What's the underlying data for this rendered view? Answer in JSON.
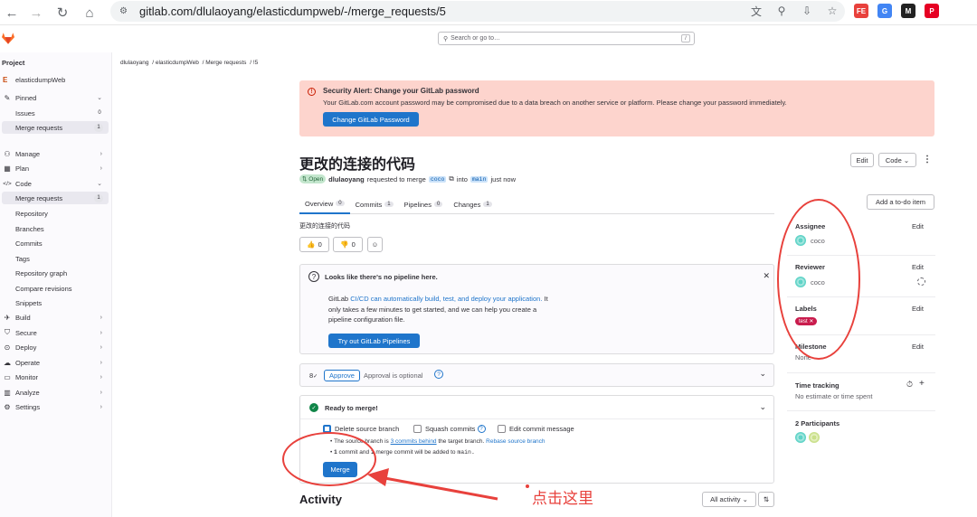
{
  "browser": {
    "url": "gitlab.com/dlulaoyang/elasticdumpweb/-/merge_requests/5",
    "extensions": [
      {
        "name": "fe-extension-icon",
        "label": "FE",
        "color": "#e8413c"
      },
      {
        "name": "translate-extension-icon",
        "label": "G",
        "color": "#4285f4"
      },
      {
        "name": "m-extension-icon",
        "label": "M",
        "color": "#222222"
      },
      {
        "name": "pinterest-extension-icon",
        "label": "P",
        "color": "#e60023"
      }
    ]
  },
  "topbar": {
    "search_placeholder": "Search or go to…",
    "search_kbd": "/"
  },
  "sidebar": {
    "heading": "Project",
    "project_initial": "E",
    "project_name": "elasticdumpWeb",
    "pinned": "Pinned",
    "issues": "Issues",
    "issues_count": "0",
    "merge_requests": "Merge requests",
    "mr_count": "1",
    "manage": "Manage",
    "plan": "Plan",
    "code": "Code",
    "code_items": [
      "Merge requests",
      "Repository",
      "Branches",
      "Commits",
      "Tags",
      "Repository graph",
      "Compare revisions",
      "Snippets"
    ],
    "code_mr_count": "1",
    "build": "Build",
    "secure": "Secure",
    "deploy": "Deploy",
    "operate": "Operate",
    "monitor": "Monitor",
    "analyze": "Analyze",
    "settings": "Settings"
  },
  "breadcrumb": [
    "dlulaoyang",
    "elasticdumpWeb",
    "Merge requests",
    "!5"
  ],
  "alert": {
    "title": "Security Alert: Change your GitLab password",
    "body": "Your GitLab.com account password may be compromised due to a data breach on another service or platform. Please change your password immediately.",
    "button": "Change GitLab Password",
    "color": "#fdd4cd"
  },
  "mr": {
    "title": "更改的连接的代码",
    "status": "Open",
    "author": "dlulaoyang",
    "requested": "requested to merge",
    "source_branch": "coco",
    "into": "into",
    "target_branch": "main",
    "time": "just now",
    "edit": "Edit",
    "code": "Code",
    "description": "更改的连接的代码",
    "thumbs_up": "0",
    "thumbs_down": "0"
  },
  "tabs": [
    {
      "label": "Overview",
      "count": "0"
    },
    {
      "label": "Commits",
      "count": "1"
    },
    {
      "label": "Pipelines",
      "count": "0"
    },
    {
      "label": "Changes",
      "count": "1"
    }
  ],
  "pipeline_card": {
    "title": "Looks like there's no pipeline here.",
    "body_prefix": "GitLab",
    "body_link": "CI/CD can automatically build, test, and deploy your application.",
    "body_line1_suffix": "It",
    "body_line2": "only takes a few minutes to get started, and we can help you create a",
    "body_line3": "pipeline configuration file.",
    "button": "Try out GitLab Pipelines"
  },
  "approval": {
    "count": "8",
    "button": "Approve",
    "text": "Approval is optional"
  },
  "merge_card": {
    "title": "Ready to merge!",
    "delete_source": "Delete source branch",
    "squash": "Squash commits",
    "edit_message": "Edit commit message",
    "line1_prefix": "The source branch is",
    "line1_link": "3 commits behind",
    "line1_mid": "the target branch.",
    "line1_link2": "Rebase source branch",
    "line2_a": "1",
    "line2_b": "commit and",
    "line2_c": "1",
    "line2_d": "merge commit will be added to",
    "line2_branch": "main.",
    "button": "Merge"
  },
  "activity": {
    "title": "Activity",
    "filter": "All activity"
  },
  "right_sidebar": {
    "todo": "Add a to-do item",
    "assignee_label": "Assignee",
    "assignee": "coco",
    "reviewer_label": "Reviewer",
    "reviewer": "coco",
    "labels_label": "Labels",
    "label_value": "test",
    "milestone_label": "Milestone",
    "milestone": "None",
    "time_label": "Time tracking",
    "time_value": "No estimate or time spent",
    "participants": "2 Participants",
    "edit": "Edit"
  },
  "annotation": {
    "text": "点击这里",
    "color": "#e8413c"
  }
}
